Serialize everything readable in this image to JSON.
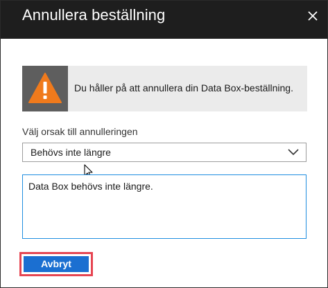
{
  "dialog": {
    "title": "Annullera beställning",
    "close_icon": "close-icon"
  },
  "warning": {
    "icon": "warning-triangle-icon",
    "icon_color": "#f07a1c",
    "message": "Du håller på att annullera din Data Box-beställning."
  },
  "reason": {
    "label": "Välj orsak till annulleringen",
    "selected": "Behövs inte längre",
    "comment": "Data Box behövs inte längre."
  },
  "actions": {
    "cancel_label": "Avbryt",
    "cancel_color": "#1b6fd1",
    "highlight_color": "#e64552"
  }
}
